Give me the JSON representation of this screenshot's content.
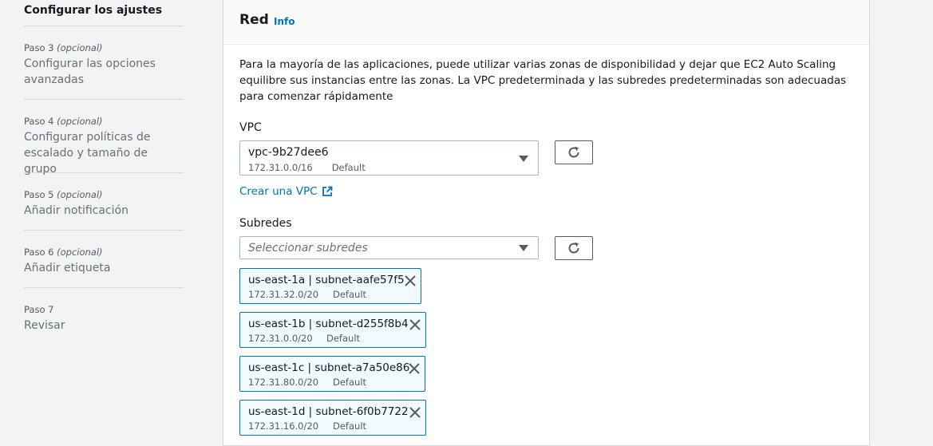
{
  "nav": {
    "current": "Configurar los ajustes",
    "steps": [
      {
        "num": "Paso 3",
        "opt": "(opcional)",
        "title": "Configurar las opciones avanzadas"
      },
      {
        "num": "Paso 4",
        "opt": "(opcional)",
        "title": "Configurar políticas de escalado y tamaño de grupo"
      },
      {
        "num": "Paso 5",
        "opt": "(opcional)",
        "title": "Añadir notificación"
      },
      {
        "num": "Paso 6",
        "opt": "(opcional)",
        "title": "Añadir etiqueta"
      },
      {
        "num": "Paso 7",
        "opt": "",
        "title": "Revisar"
      }
    ]
  },
  "network": {
    "title": "Red",
    "info": "Info",
    "description": "Para la mayoría de las aplicaciones, puede utilizar varias zonas de disponibilidad y dejar que EC2 Auto Scaling equilibre sus instancias entre las zonas. La VPC predeterminada y las subredes predeterminadas son adecuadas para comenzar rápidamente",
    "vpc": {
      "label": "VPC",
      "value": "vpc-9b27dee6",
      "cidr": "172.31.0.0/16",
      "tag": "Default",
      "create_link": "Crear una VPC"
    },
    "subnets": {
      "label": "Subredes",
      "placeholder": "Seleccionar subredes",
      "selected": [
        {
          "name": "us-east-1a | subnet-aafe57f5",
          "cidr": "172.31.32.0/20",
          "tag": "Default"
        },
        {
          "name": "us-east-1b | subnet-d255f8b4",
          "cidr": "172.31.0.0/20",
          "tag": "Default"
        },
        {
          "name": "us-east-1c | subnet-a7a50e86",
          "cidr": "172.31.80.0/20",
          "tag": "Default"
        },
        {
          "name": "us-east-1d | subnet-6f0b7722",
          "cidr": "172.31.16.0/20",
          "tag": "Default"
        }
      ]
    }
  }
}
